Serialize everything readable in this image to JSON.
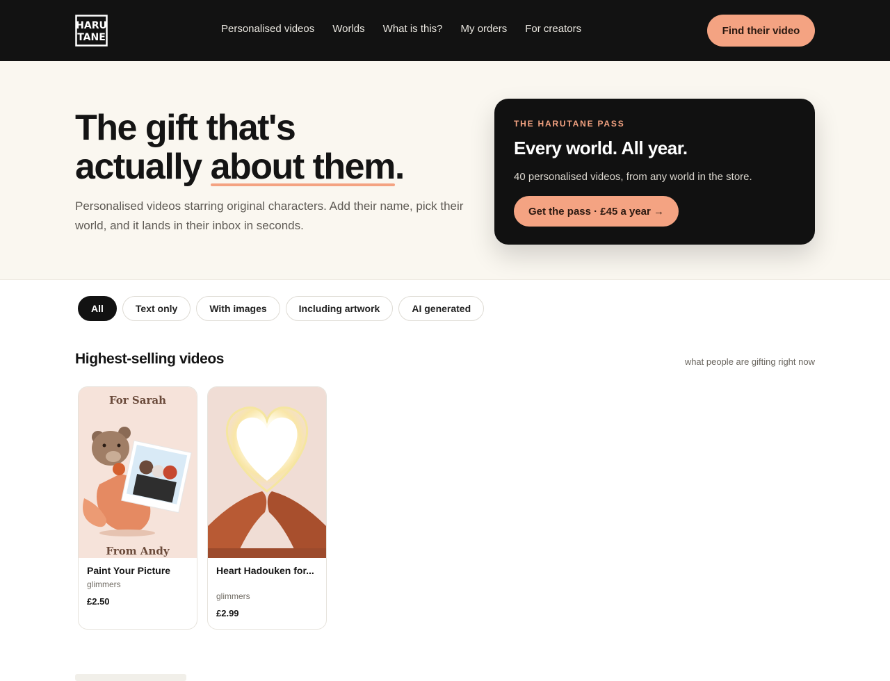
{
  "brand": {
    "logo_line1": "HARU",
    "logo_line2": "TANE"
  },
  "nav": {
    "items": [
      "Personalised videos",
      "Worlds",
      "What is this?",
      "My orders",
      "For creators"
    ],
    "cta": "Find their video"
  },
  "hero": {
    "title_line1": "The gift that's",
    "title_line2_a": "actually ",
    "title_line2_highlight": "about them",
    "title_line2_end": ".",
    "subtitle": "Personalised videos starring original characters. Add their name, pick their world, and it lands in their inbox in seconds."
  },
  "pass": {
    "kicker": "THE HARUTANE PASS",
    "title": "Every world. All year.",
    "description": "40 personalised videos, from any world in the store.",
    "button": "Get the pass · £45 a year →"
  },
  "filters": [
    "All",
    "Text only",
    "With images",
    "Including artwork",
    "AI generated"
  ],
  "section": {
    "title": "Highest-selling videos",
    "note": "what people are gifting right now"
  },
  "cards": [
    {
      "name": "Paint Your Picture",
      "creator": "glimmers",
      "price": "£2.50",
      "thumb_top": "For Sarah",
      "thumb_bottom": "From Andy"
    },
    {
      "name": "Heart Hadouken for...",
      "creator": "glimmers",
      "price": "£2.99"
    }
  ],
  "colors": {
    "accent": "#f4a382",
    "dark": "#121212",
    "hero_bg": "#faf7f0"
  }
}
